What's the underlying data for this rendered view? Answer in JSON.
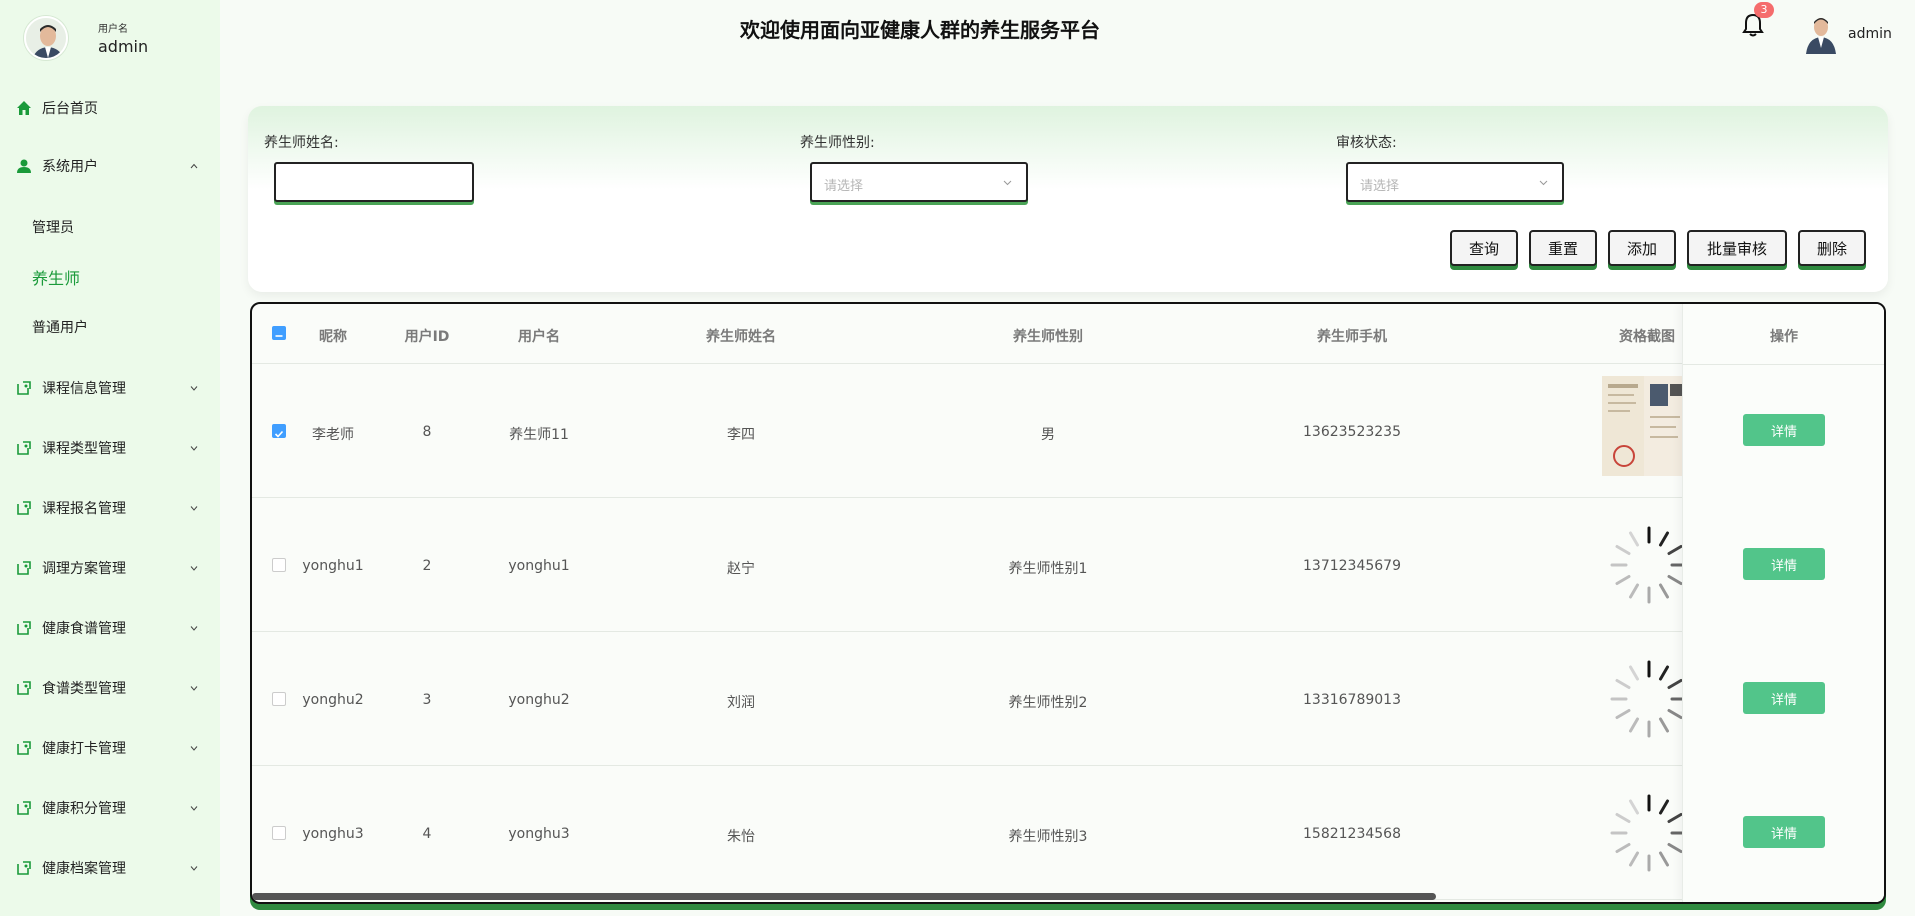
{
  "header": {
    "title": "欢迎使用面向亚健康人群的养生服务平台",
    "notification_count": "3",
    "user": "admin"
  },
  "sidebar": {
    "user_label": "用户名",
    "user_name": "admin",
    "menu": [
      {
        "label": "后台首页",
        "icon": "home-icon"
      },
      {
        "label": "系统用户",
        "icon": "user-icon",
        "expanded": true,
        "children": [
          {
            "label": "管理员"
          },
          {
            "label": "养生师",
            "active": true
          },
          {
            "label": "普通用户"
          }
        ]
      },
      {
        "label": "课程信息管理",
        "icon": "module-icon"
      },
      {
        "label": "课程类型管理",
        "icon": "module-icon"
      },
      {
        "label": "课程报名管理",
        "icon": "module-icon"
      },
      {
        "label": "调理方案管理",
        "icon": "module-icon"
      },
      {
        "label": "健康食谱管理",
        "icon": "module-icon"
      },
      {
        "label": "食谱类型管理",
        "icon": "module-icon"
      },
      {
        "label": "健康打卡管理",
        "icon": "module-icon"
      },
      {
        "label": "健康积分管理",
        "icon": "module-icon"
      },
      {
        "label": "健康档案管理",
        "icon": "module-icon"
      }
    ]
  },
  "search": {
    "name_label": "养生师姓名:",
    "name_value": "",
    "gender_label": "养生师性别:",
    "gender_placeholder": "请选择",
    "status_label": "审核状态:",
    "status_placeholder": "请选择",
    "buttons": {
      "query": "查询",
      "reset": "重置",
      "add": "添加",
      "batch_review": "批量审核",
      "delete": "删除"
    }
  },
  "table": {
    "columns": [
      "昵称",
      "用户ID",
      "用户名",
      "养生师姓名",
      "养生师性别",
      "养生师手机",
      "资格截图",
      "操作"
    ],
    "detail_label": "详情",
    "rows": [
      {
        "nickname": "李老师",
        "user_id": "8",
        "username": "养生师11",
        "name": "李四",
        "gender": "男",
        "phone": "13623523235",
        "checked": true,
        "image": "certificate-photo"
      },
      {
        "nickname": "yonghu1",
        "user_id": "2",
        "username": "yonghu1",
        "name": "赵宁",
        "gender": "养生师性别1",
        "phone": "13712345679",
        "checked": false,
        "image": "loading"
      },
      {
        "nickname": "yonghu2",
        "user_id": "3",
        "username": "yonghu2",
        "name": "刘润",
        "gender": "养生师性别2",
        "phone": "13316789013",
        "checked": false,
        "image": "loading"
      },
      {
        "nickname": "yonghu3",
        "user_id": "4",
        "username": "yonghu3",
        "name": "朱怡",
        "gender": "养生师性别3",
        "phone": "15821234568",
        "checked": false,
        "image": "loading"
      }
    ]
  },
  "colors": {
    "accent": "#1a9a3a",
    "sidebar_bg": "#ecfaea",
    "detail_button": "#52c58a",
    "checkbox": "#409eff",
    "badge": "#f56c6c"
  }
}
